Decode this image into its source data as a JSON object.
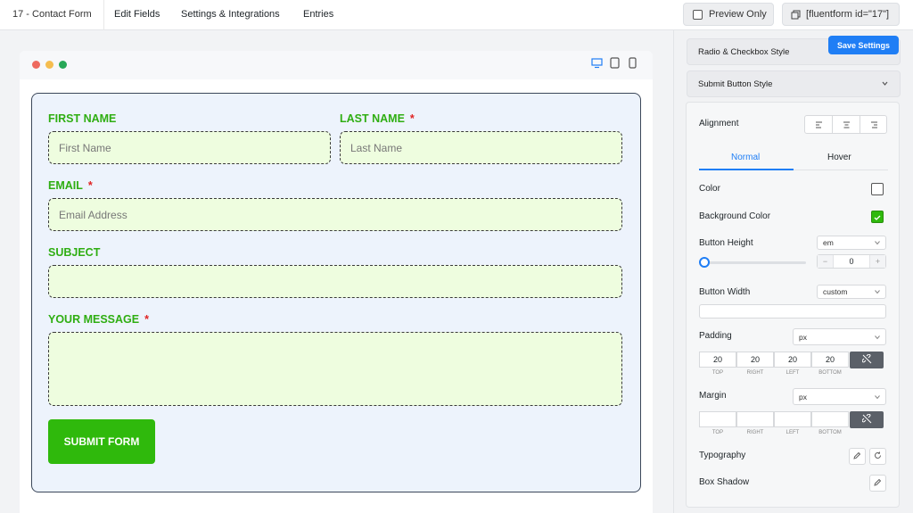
{
  "topbar": {
    "title": "17 - Contact Form",
    "nav": [
      "Edit Fields",
      "Settings & Integrations",
      "Entries"
    ],
    "preview_label": "Preview Only",
    "shortcode": "[fluentform id=\"17\"]"
  },
  "form": {
    "first_name_label": "FIRST NAME",
    "first_name_placeholder": "First Name",
    "last_name_label": "LAST NAME",
    "last_name_placeholder": "Last Name",
    "email_label": "EMAIL",
    "email_placeholder": "Email Address",
    "subject_label": "SUBJECT",
    "message_label": "YOUR MESSAGE",
    "required_mark": "*",
    "submit_label": "SUBMIT FORM"
  },
  "panel": {
    "save_label": "Save Settings",
    "radio_checkbox_style": "Radio & Checkbox Style",
    "submit_button_style": "Submit Button Style",
    "alignment_label": "Alignment",
    "tabs": [
      "Normal",
      "Hover"
    ],
    "color_label": "Color",
    "background_color_label": "Background Color",
    "background_color_value": "#2fb90c",
    "button_height_label": "Button Height",
    "button_height_unit": "em",
    "button_height_value": "0",
    "stepper_minus": "−",
    "stepper_plus": "+",
    "button_width_label": "Button Width",
    "button_width_unit": "custom",
    "padding_label": "Padding",
    "padding_unit": "px",
    "padding_values": [
      "20",
      "20",
      "20",
      "20"
    ],
    "sides": [
      "TOP",
      "RIGHT",
      "LEFT",
      "BOTTOM"
    ],
    "margin_label": "Margin",
    "margin_unit": "px",
    "typography_label": "Typography",
    "box_shadow_label": "Box Shadow"
  },
  "colors": {
    "accent": "#1f7ef5",
    "form_label": "#2fae12",
    "required": "#e02424",
    "submit_bg": "#2fb90c"
  }
}
